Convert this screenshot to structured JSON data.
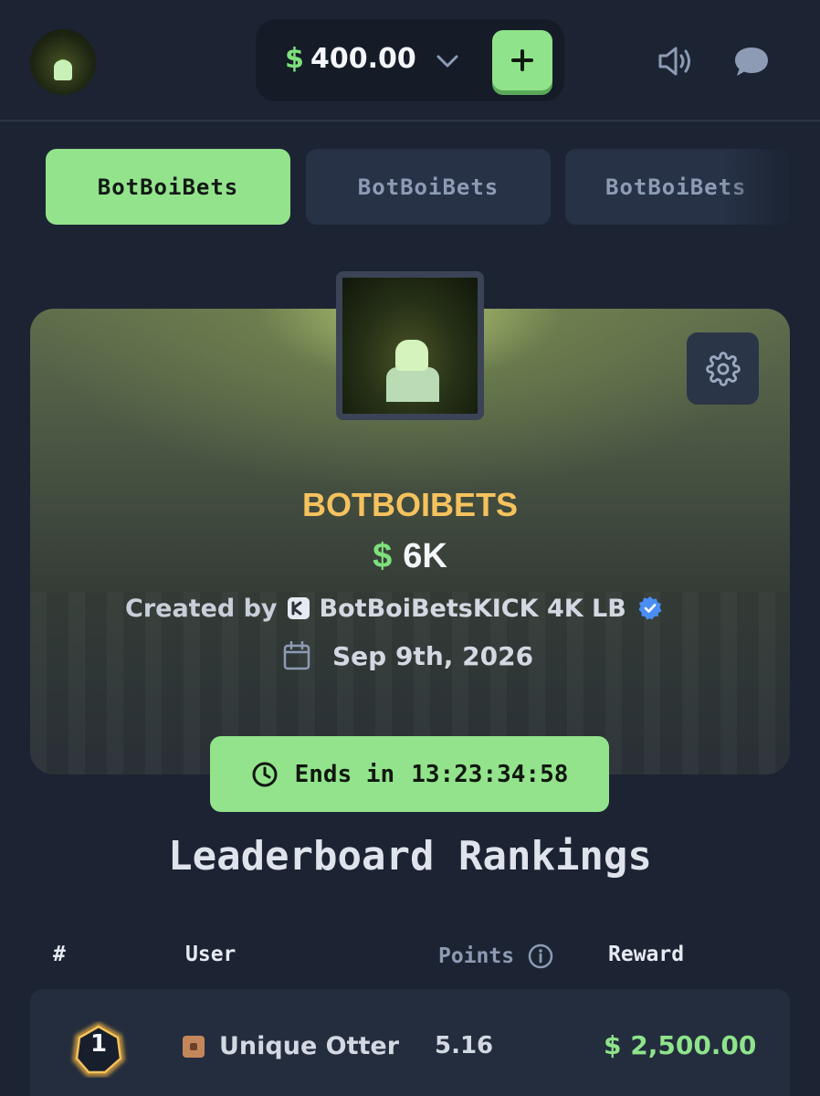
{
  "header": {
    "currency_symbol": "$",
    "balance": "400.00",
    "icons": [
      "chevron-down-icon",
      "plus-icon",
      "speaker-icon",
      "chat-icon"
    ]
  },
  "tabs": [
    {
      "label": "BotBoiBets",
      "active": true
    },
    {
      "label": "BotBoiBets",
      "active": false
    },
    {
      "label": "BotBoiBets",
      "active": false
    }
  ],
  "leaderboard_card": {
    "title": "BOTBOIBETS",
    "prize_currency": "$",
    "prize": "6K",
    "created_by_label": "Created by",
    "creator": "BotBoiBetsKICK 4K LB",
    "date": "Sep 9th, 2026",
    "ends_label": "Ends in",
    "countdown": "13:23:34:58"
  },
  "rankings": {
    "title": "Leaderboard Rankings",
    "columns": {
      "rank": "#",
      "user": "User",
      "points": "Points",
      "reward": "Reward"
    },
    "rows": [
      {
        "rank": "1",
        "user": "Unique Otter",
        "points": "5.16",
        "reward": "$ 2,500.00"
      }
    ]
  },
  "colors": {
    "accent_green": "#93e38c",
    "title_gold": "#f6c25d",
    "background": "#1c2433"
  }
}
